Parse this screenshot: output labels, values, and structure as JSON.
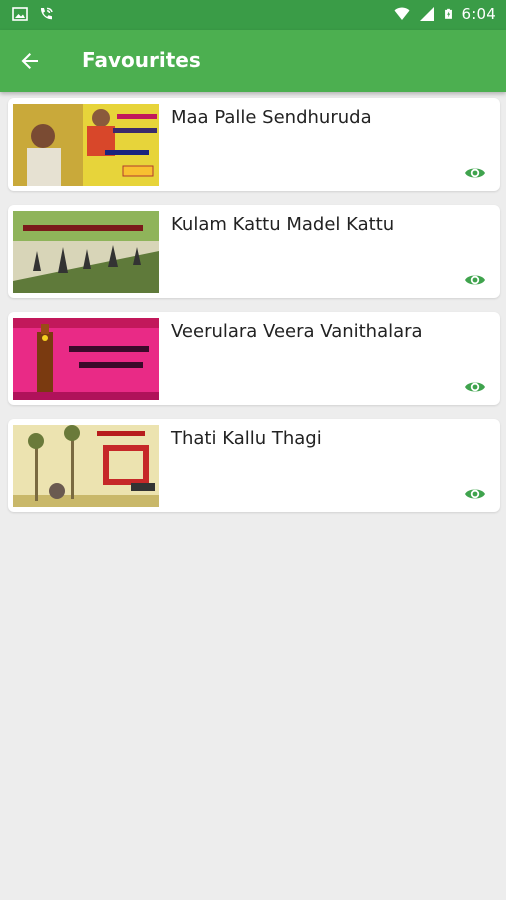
{
  "status_bar": {
    "time": "6:04",
    "icons": [
      "image-icon",
      "wifi-calling-icon",
      "wifi-icon",
      "signal-icon",
      "battery-icon"
    ]
  },
  "app_bar": {
    "title": "Favourites",
    "back_icon": "arrow-back-icon",
    "color": "#4caf50",
    "status_color": "#3a9c47"
  },
  "favourites": [
    {
      "title": "Maa Palle Sendhuruda",
      "thumbnail": "song-thumbnail-1",
      "action_icon": "eye-icon"
    },
    {
      "title": "Kulam Kattu Madel Kattu",
      "thumbnail": "song-thumbnail-2",
      "action_icon": "eye-icon"
    },
    {
      "title": "Veerulara Veera Vanithalara",
      "thumbnail": "song-thumbnail-3",
      "action_icon": "eye-icon"
    },
    {
      "title": "Thati Kallu Thagi",
      "thumbnail": "song-thumbnail-4",
      "action_icon": "eye-icon"
    }
  ],
  "accent_color": "#3fa34d"
}
